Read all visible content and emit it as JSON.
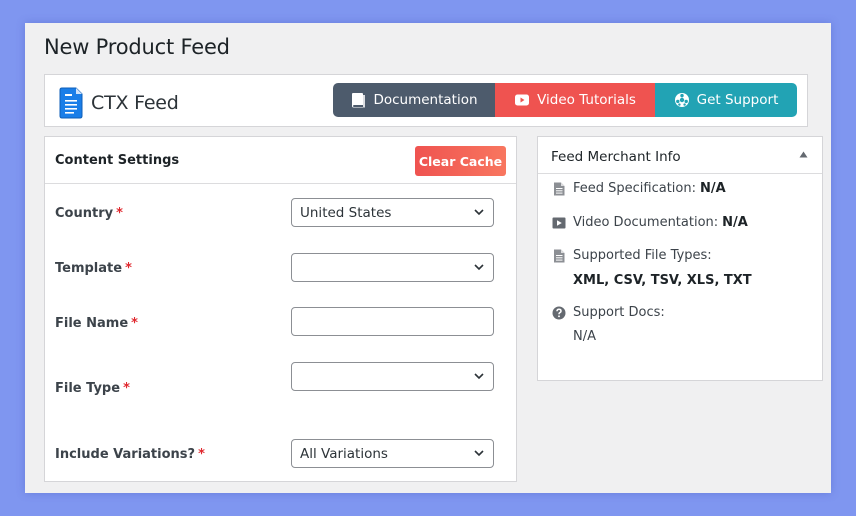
{
  "page": {
    "title": "New Product Feed"
  },
  "header": {
    "logo_text": "CTX Feed",
    "buttons": [
      {
        "label": "Documentation",
        "icon": "book-icon",
        "color": "#4d5b6c"
      },
      {
        "label": "Video Tutorials",
        "icon": "youtube-icon",
        "color": "#ef5350"
      },
      {
        "label": "Get Support",
        "icon": "support-icon",
        "color": "#22a3b4"
      }
    ]
  },
  "content_settings": {
    "title": "Content Settings",
    "clear_cache_label": "Clear Cache",
    "required_mark": "*",
    "fields": {
      "country": {
        "label": "Country",
        "value": "United States"
      },
      "template": {
        "label": "Template",
        "value": ""
      },
      "file_name": {
        "label": "File Name",
        "value": "",
        "placeholder": ""
      },
      "file_type": {
        "label": "File Type",
        "value": ""
      },
      "include_variations": {
        "label": "Include Variations?",
        "value": "All Variations"
      }
    }
  },
  "merchant_info": {
    "title": "Feed Merchant Info",
    "feed_spec": {
      "label": "Feed Specification:",
      "value": "N/A"
    },
    "video_doc": {
      "label": "Video Documentation:",
      "value": "N/A"
    },
    "file_types": {
      "label": "Supported File Types:",
      "value": "XML, CSV, TSV, XLS, TXT"
    },
    "support_docs": {
      "label": "Support Docs:",
      "value": "N/A"
    }
  }
}
